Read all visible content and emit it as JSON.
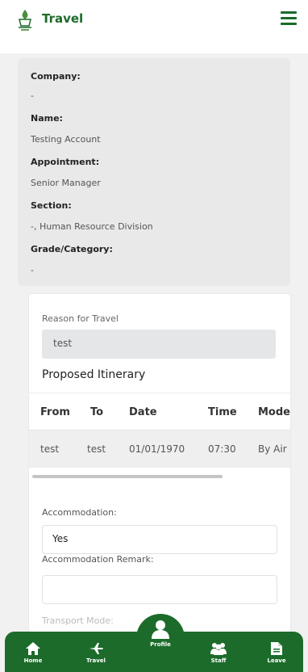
{
  "header": {
    "title": "Travel"
  },
  "profile": {
    "company_label": "Company:",
    "company_value": "-",
    "name_label": "Name:",
    "name_value": "Testing Account",
    "appointment_label": "Appointment:",
    "appointment_value": "Senior Manager",
    "section_label": "Section:",
    "section_value": "-, Human Resource Division",
    "grade_label": "Grade/Category:",
    "grade_value": "-"
  },
  "travel": {
    "reason_label": "Reason for Travel",
    "reason_value": "test",
    "itinerary_title": "Proposed Itinerary",
    "columns": [
      "From",
      "To",
      "Date",
      "Time",
      "Mode"
    ],
    "rows": [
      {
        "from": "test",
        "to": "test",
        "date": "01/01/1970",
        "time": "07:30",
        "mode": "By Air"
      }
    ],
    "accommodation_label": "Accommodation:",
    "accommodation_value": "Yes",
    "accommodation_remark_label": "Accommodation Remark:",
    "accommodation_remark_value": "",
    "next_label_partial": "Transport Mode:"
  },
  "nav": {
    "items": [
      {
        "label": "Home",
        "icon": "home-icon"
      },
      {
        "label": "Travel",
        "icon": "plane-icon"
      },
      {
        "label": "Profile",
        "icon": "user-icon"
      },
      {
        "label": "Staff",
        "icon": "users-icon"
      },
      {
        "label": "Leave",
        "icon": "document-icon"
      }
    ],
    "active": "Profile"
  },
  "colors": {
    "brand": "#1c6b2b",
    "card_bg": "#e9e9e9",
    "input_bg": "#e4e6e8"
  }
}
